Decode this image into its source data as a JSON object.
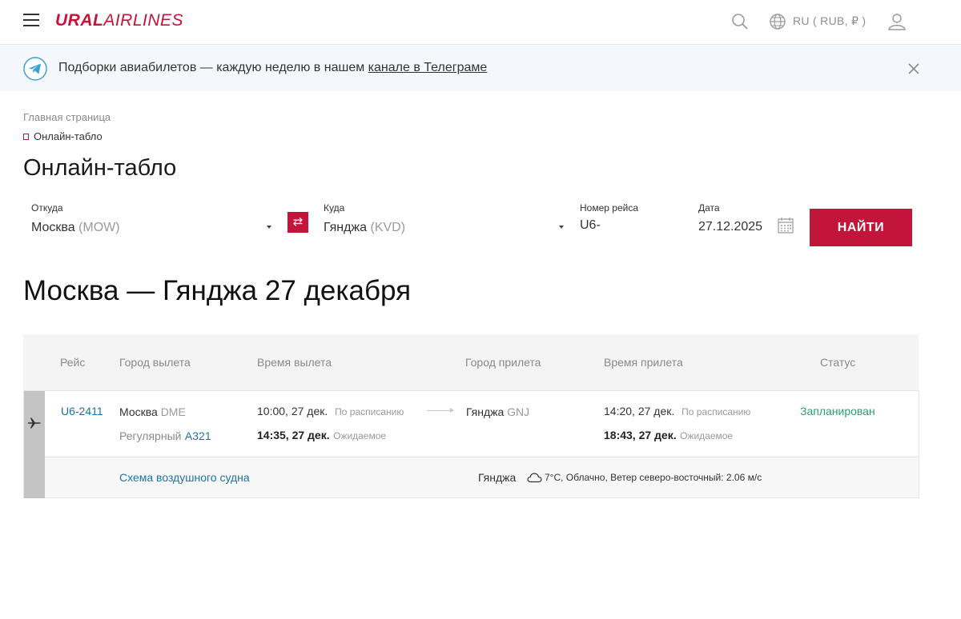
{
  "header": {
    "logo_bold": "URAL",
    "logo_light": "AIRLINES",
    "lang_currency": "RU ( RUB, ₽ )"
  },
  "banner": {
    "text": "Подборки авиабилетов — каждую неделю в нашем ",
    "link": "канале в Телеграме"
  },
  "breadcrumb": {
    "home": "Главная страница",
    "current": "Онлайн-табло"
  },
  "page_title": "Онлайн-табло",
  "search": {
    "from_label": "Откуда",
    "from_city": "Москва",
    "from_code": "(MOW)",
    "to_label": "Куда",
    "to_city": "Гянджа",
    "to_code": "(KVD)",
    "flight_label": "Номер рейса",
    "flight_value": "U6-",
    "date_label": "Дата",
    "date_value": "27.12.2025",
    "swap_icon": "⇄",
    "find_label": "НАЙТИ"
  },
  "route_title": "Москва — Гянджа 27 декабря",
  "table": {
    "columns": [
      "Рейс",
      "Город вылета",
      "Время вылета",
      "Город прилета",
      "Время прилета",
      "Статус"
    ],
    "rows": [
      {
        "flight": "U6-2411",
        "dep_city": "Москва",
        "dep_code": "DME",
        "service": "Регулярный",
        "aircraft": "A321",
        "dep_sched_time": "10:00, 27 дек.",
        "dep_sched_note": "По расписанию",
        "dep_exp_time": "14:35, 27 дек.",
        "dep_exp_note": "Ожидаемое",
        "arr_city": "Гянджа",
        "arr_code": "GNJ",
        "arr_sched_time": "14:20, 27 дек.",
        "arr_sched_note": "По расписанию",
        "arr_exp_time": "18:43, 27 дек.",
        "arr_exp_note": "Ожидаемое",
        "status": "Запланирован",
        "seat_map_link": "Схема воздушного судна",
        "weather_city": "Гянджа",
        "weather_text": "7°C, Облачно, Ветер северо-восточный: 2.06 м/с"
      }
    ]
  },
  "colors": {
    "brand": "#c3143a",
    "link": "#1a73a8",
    "status_ok": "#2e9e6e"
  }
}
